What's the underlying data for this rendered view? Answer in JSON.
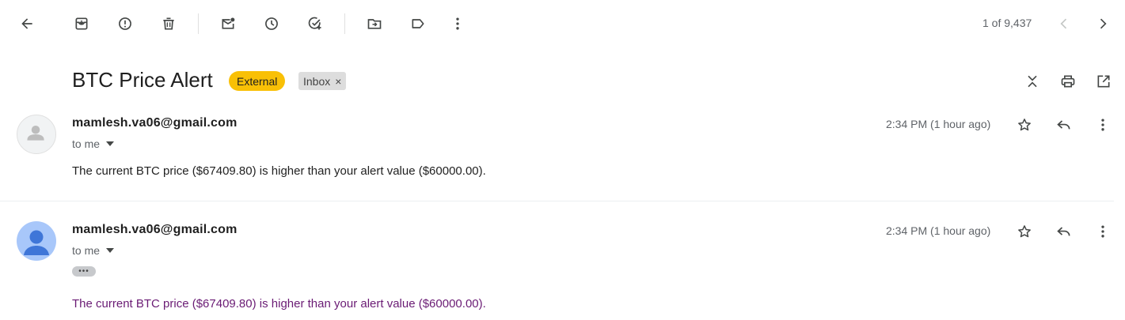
{
  "toolbar": {
    "back_icon": "arrow-left-icon",
    "icons": [
      "archive-icon",
      "report-spam-icon",
      "delete-icon",
      "mark-unread-icon",
      "snooze-icon",
      "add-to-tasks-icon",
      "move-to-icon",
      "label-icon",
      "more-vert-icon"
    ],
    "pagination": "1 of 9,437"
  },
  "subject": {
    "title": "BTC Price Alert",
    "badge_external": "External",
    "badge_inbox": "Inbox",
    "badge_inbox_remove": "×"
  },
  "messages": [
    {
      "sender": "mamlesh.va06@gmail.com",
      "to": "to me",
      "time": "2:34 PM (1 hour ago)",
      "body": "The current BTC price ($67409.80) is higher than your alert value ($60000.00)."
    },
    {
      "sender": "mamlesh.va06@gmail.com",
      "to": "to me",
      "time": "2:34 PM (1 hour ago)",
      "trimmed": "•••",
      "body": "The current BTC price ($67409.80) is higher than your alert value ($60000.00)."
    }
  ],
  "colors": {
    "external_badge": "#f9c006",
    "inbox_badge": "#dddddd",
    "avatar_blue": "#a8c7fa",
    "avatar_blue_dark": "#3f76d8",
    "quoted_text": "#6a1b74"
  }
}
